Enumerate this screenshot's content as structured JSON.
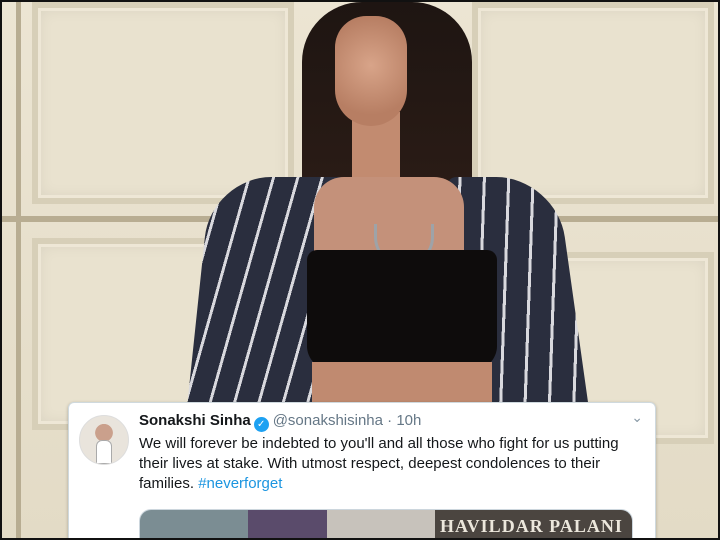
{
  "tweet": {
    "display_name": "Sonakshi Sinha",
    "handle": "@sonakshisinha",
    "separator": "·",
    "time": "10h",
    "verified_glyph": "✓",
    "chevron_glyph": "⌄",
    "text": "We will forever be indebted to you'll and all those who fight for us putting their lives at stake. With utmost respect, deepest condolences to their families. ",
    "hashtag": "#neverforget",
    "media_caption": "HAVILDAR PALANI"
  },
  "icons": {
    "verified": "verified-badge-icon",
    "more": "chevron-down-icon"
  },
  "colors": {
    "verified_blue": "#1da1f2",
    "hashtag_blue": "#1b95e0",
    "name_text": "#14171a",
    "muted_text": "#657786"
  }
}
